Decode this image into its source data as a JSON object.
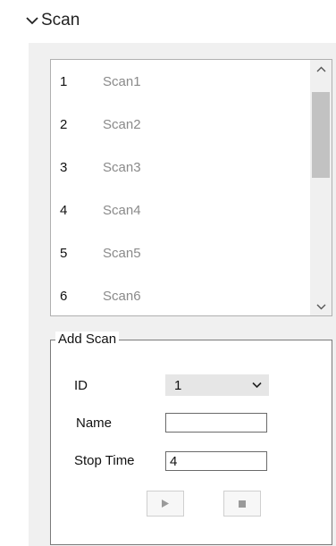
{
  "section": {
    "title": "Scan",
    "expanded": true
  },
  "scan_list": {
    "items": [
      {
        "id": "1",
        "name": "Scan1"
      },
      {
        "id": "2",
        "name": "Scan2"
      },
      {
        "id": "3",
        "name": "Scan3"
      },
      {
        "id": "4",
        "name": "Scan4"
      },
      {
        "id": "5",
        "name": "Scan5"
      },
      {
        "id": "6",
        "name": "Scan6"
      }
    ]
  },
  "add_scan": {
    "legend": "Add Scan",
    "id_label": "ID",
    "id_value": "1",
    "name_label": "Name",
    "name_value": "",
    "stop_time_label": "Stop Time",
    "stop_time_value": "4"
  },
  "buttons": {
    "play_icon": "play-icon",
    "stop_icon": "stop-icon"
  },
  "colors": {
    "panel_bg": "#f0f0f0",
    "scan_name_text": "#8a8a8a",
    "select_bg": "#e6e6e6"
  }
}
